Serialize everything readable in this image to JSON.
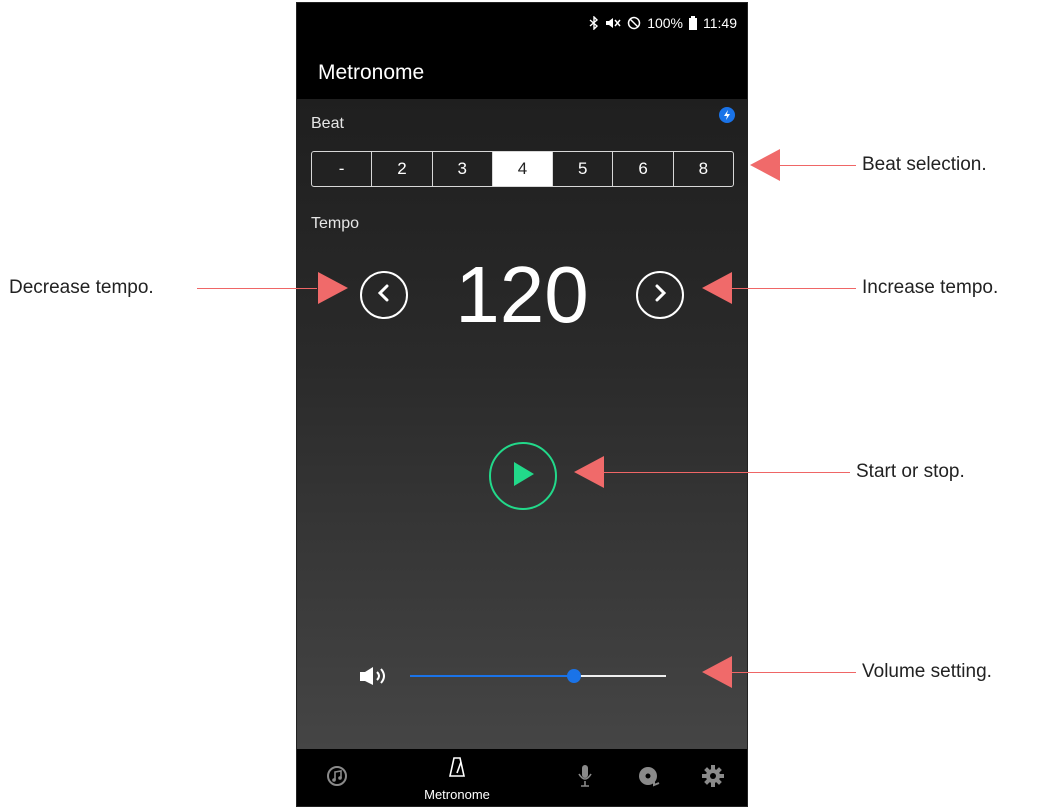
{
  "status": {
    "battery": "100%",
    "time": "11:49"
  },
  "app": {
    "title": "Metronome"
  },
  "beat": {
    "label": "Beat",
    "options": [
      "-",
      "2",
      "3",
      "4",
      "5",
      "6",
      "8"
    ],
    "selected": "4"
  },
  "tempo": {
    "label": "Tempo",
    "value": "120"
  },
  "volume": {
    "level": 0.64
  },
  "nav": {
    "metronome_label": "Metronome"
  },
  "annotations": {
    "beat_selection": "Beat selection.",
    "decrease_tempo": "Decrease tempo.",
    "increase_tempo": "Increase tempo.",
    "start_stop": "Start or stop.",
    "volume_setting": "Volume setting."
  },
  "colors": {
    "accent_blue": "#1a73e8",
    "play_green": "#22d98a",
    "arrow_red": "#f06a6a"
  },
  "icons": [
    "bluetooth-icon",
    "mute-icon",
    "dnd-icon",
    "battery-icon",
    "sync-icon",
    "chevron-left-icon",
    "chevron-right-icon",
    "play-icon",
    "volume-icon",
    "tuner-icon",
    "metronome-icon",
    "mic-icon",
    "player-icon",
    "settings-icon"
  ]
}
